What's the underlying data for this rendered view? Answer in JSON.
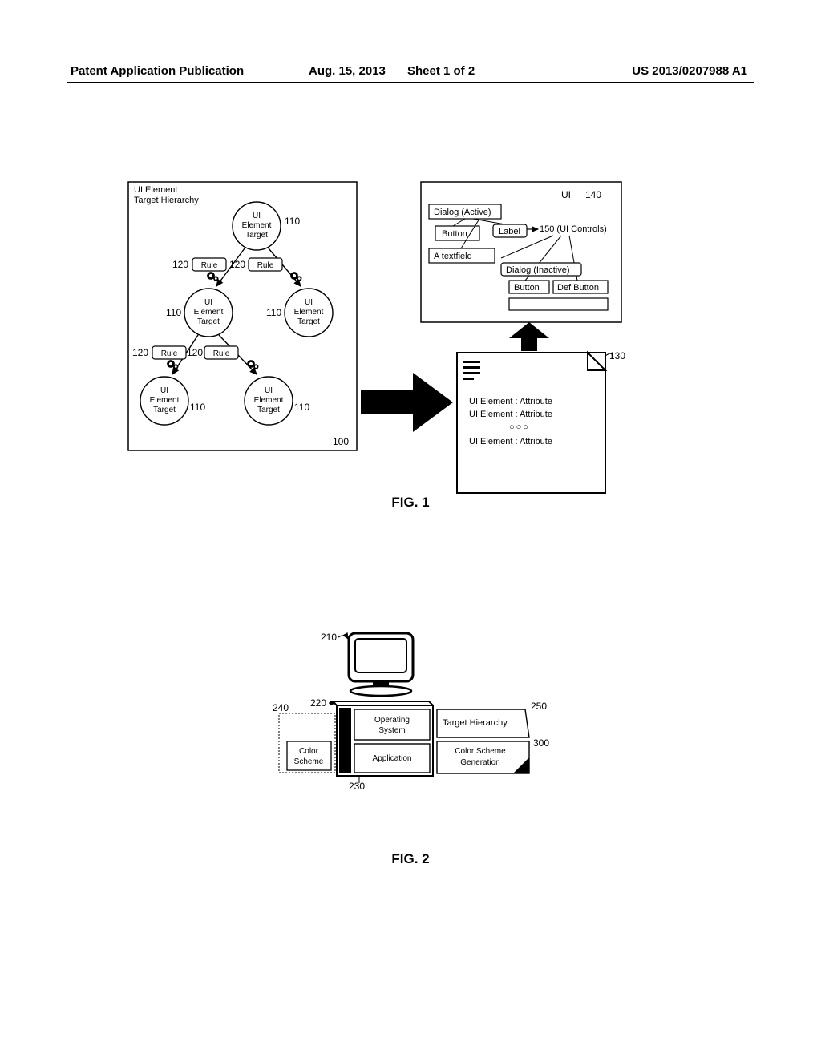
{
  "header": {
    "publication_label": "Patent Application Publication",
    "date": "Aug. 15, 2013",
    "sheet": "Sheet 1 of 2",
    "pub_number": "US 2013/0207988 A1"
  },
  "fig1": {
    "caption": "FIG. 1",
    "hierarchy_title_line1": "UI Element",
    "hierarchy_title_line2": "Target Hierarchy",
    "node_line1": "UI",
    "node_line2": "Element",
    "node_line3": "Target",
    "rule_label": "Rule",
    "refs": {
      "box": "100",
      "node": "110",
      "rule": "120",
      "doc": "130",
      "ui": "140",
      "controls": "150 (UI Controls)"
    },
    "ui_label": "UI",
    "dialog_active": "Dialog (Active)",
    "button": "Button",
    "label": "Label",
    "textfield": "A textfield",
    "dialog_inactive": "Dialog (Inactive)",
    "def_button": "Def Button",
    "doc_line1": "UI Element : Attribute",
    "doc_line2": "UI Element : Attribute",
    "doc_ellipsis": "○○○",
    "doc_line3": "UI Element : Attribute"
  },
  "fig2": {
    "caption": "FIG. 2",
    "refs": {
      "monitor": "210",
      "tower": "220",
      "app": "230",
      "scheme": "240",
      "hierarchy": "250",
      "generation": "300"
    },
    "os": "Operating",
    "os2": "System",
    "app": "Application",
    "scheme1": "Color",
    "scheme2": "Scheme",
    "hierarchy": "Target Hierarchy",
    "gen1": "Color Scheme",
    "gen2": "Generation"
  }
}
